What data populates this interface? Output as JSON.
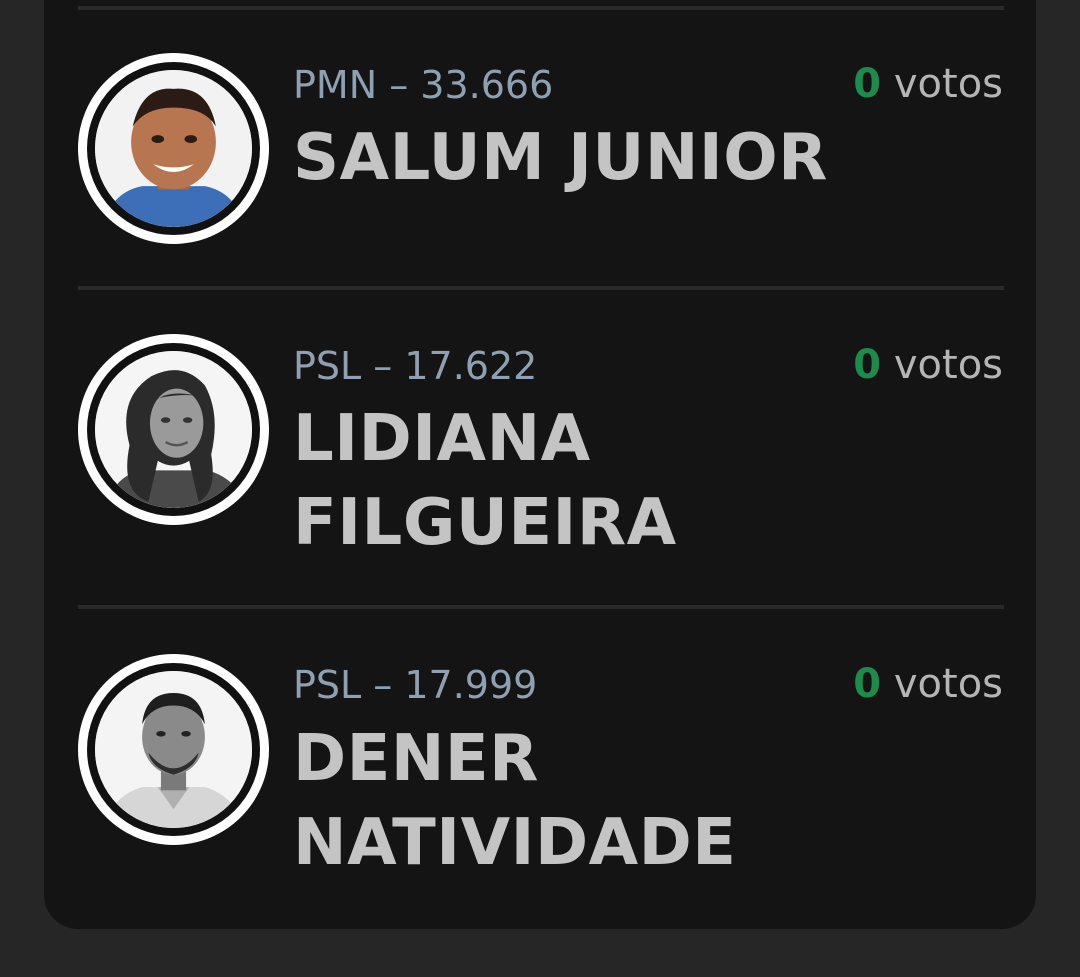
{
  "candidates": [
    {
      "party_number": "PMN – 33.666",
      "name": "SALUM JUNIOR",
      "votes_count": "0",
      "votes_label": "votos",
      "photo": "color-portrait"
    },
    {
      "party_number": "PSL – 17.622",
      "name": "LIDIANA FILGUEIRA",
      "votes_count": "0",
      "votes_label": "votos",
      "photo": "grayscale-portrait"
    },
    {
      "party_number": "PSL – 17.999",
      "name": "DENER NATIVIDADE",
      "votes_count": "0",
      "votes_label": "votos",
      "photo": "grayscale-portrait"
    }
  ],
  "colors": {
    "page_bg": "#262626",
    "card_bg": "#141414",
    "votes_count": "#1e8a4c",
    "party_text": "#8fa0b2",
    "name_text": "#c4c4c4"
  }
}
